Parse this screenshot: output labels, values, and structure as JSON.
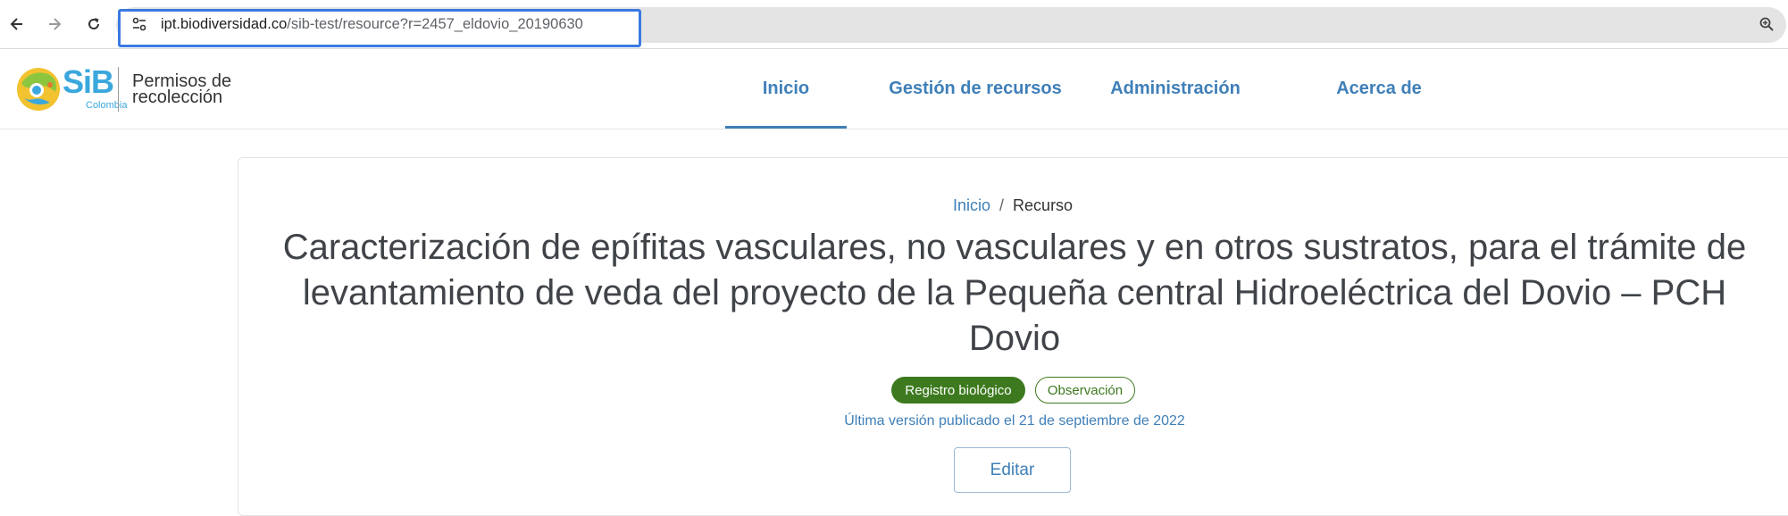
{
  "browser": {
    "back_icon": "arrow-left-icon",
    "forward_icon": "arrow-right-icon",
    "reload_icon": "reload-icon",
    "site_info_icon": "tune-icon",
    "zoom_icon": "zoom-icon",
    "url_host": "ipt.biodiversidad.co",
    "url_path": "/sib-test/resource?r=2457_eldovio_20190630",
    "highlight_color": "#3a7ae0"
  },
  "header": {
    "logo_sib": "SiB",
    "logo_colombia": "Colombia",
    "logo_line1": "Permisos de",
    "logo_line2": "recolección",
    "nav": [
      {
        "label": "Inicio",
        "active": true
      },
      {
        "label": "Gestión de recursos",
        "active": false
      },
      {
        "label": "Administración",
        "active": false
      },
      {
        "label": "Acerca de",
        "active": false
      }
    ],
    "accent_color": "#3f7fb8"
  },
  "main": {
    "breadcrumb": {
      "home": "Inicio",
      "separator": "/",
      "current": "Recurso"
    },
    "title": "Caracterización de epífitas vasculares, no vasculares y en otros sustratos, para el trámite de levantamiento de veda del proyecto de la Pequeña central Hidroeléctrica del Dovio – PCH Dovio",
    "tags": {
      "primary": "Registro biológico",
      "secondary": "Observación",
      "color": "#3d7a1f"
    },
    "version": "Última versión publicado el 21 de septiembre de 2022",
    "edit_label": "Editar"
  }
}
